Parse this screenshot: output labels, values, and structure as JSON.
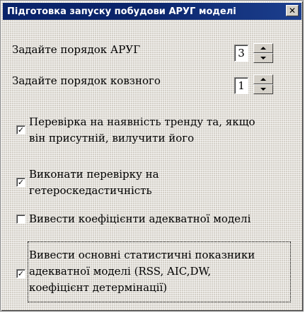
{
  "dialog": {
    "title": "Підготовка запуску побудови АРУГ моделі",
    "close_label": "✕"
  },
  "order_arug": {
    "label": "Задайте порядок АРУГ",
    "value": "3"
  },
  "order_moving": {
    "label": "Задайте порядок ковзного",
    "value": "1"
  },
  "checkboxes": [
    {
      "label_lines": [
        "Перевірка на наявність тренду та, якщо",
        "він присутній, вилучити його"
      ],
      "checked": true,
      "mark": "✓"
    },
    {
      "label_lines": [
        "Виконати перевірку на",
        "гетероскедастичність"
      ],
      "checked": true,
      "mark": "✓"
    },
    {
      "label_lines": [
        "Вивести коефіцієнти адекватної моделі"
      ],
      "checked": false,
      "mark": ""
    },
    {
      "label_lines": [
        "Вивести основні статистичні показники",
        "адекватної моделі (RSS, AIC,DW,",
        "коефіцієнт детермінації)"
      ],
      "checked": true,
      "mark": "✓"
    }
  ]
}
